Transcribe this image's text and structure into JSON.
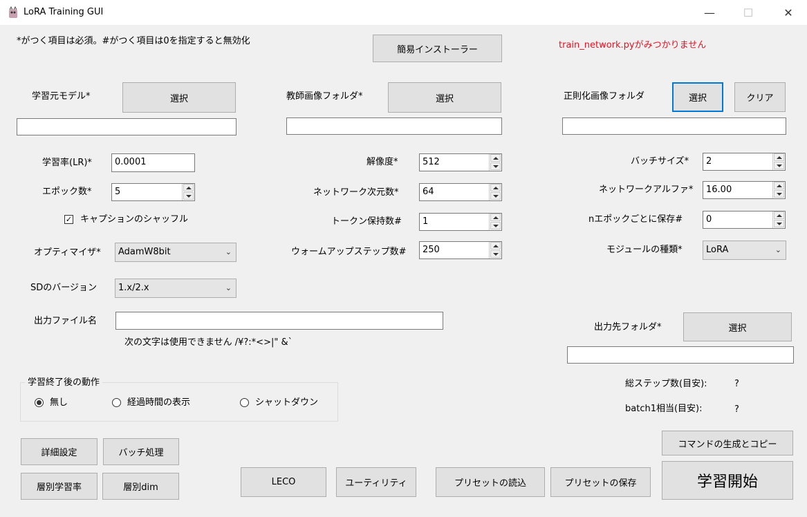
{
  "window": {
    "title": "LoRA Training GUI",
    "minimize": "—",
    "maximize": "☐",
    "close": "✕"
  },
  "notice": {
    "required": "*がつく項目は必須。#がつく項目は0を指定すると無効化",
    "error": "train_network.pyがみつかりません",
    "error_color": "#e81123"
  },
  "installer_button": "簡易インストーラー",
  "source_model": {
    "label": "学習元モデル*",
    "button": "選択",
    "value": ""
  },
  "teacher_folder": {
    "label": "教師画像フォルダ*",
    "button": "選択",
    "value": ""
  },
  "reg_folder": {
    "label": "正則化画像フォルダ",
    "button": "選択",
    "clear": "クリア",
    "value": ""
  },
  "lr": {
    "label": "学習率(LR)*",
    "value": "0.0001"
  },
  "epochs": {
    "label": "エポック数*",
    "value": "5"
  },
  "caption_shuffle": {
    "label": "キャプションのシャッフル",
    "checked": true,
    "mark": "✓"
  },
  "optimizer": {
    "label": "オプティマイザ*",
    "value": "AdamW8bit"
  },
  "sd_version": {
    "label": "SDのバージョン",
    "value": "1.x/2.x"
  },
  "output_name": {
    "label": "出力ファイル名",
    "value": "",
    "note": "次の文字は使用できません /¥?:*<>|\" &`"
  },
  "resolution": {
    "label": "解像度*",
    "value": "512"
  },
  "network_dim": {
    "label": "ネットワーク次元数*",
    "value": "64"
  },
  "keep_tokens": {
    "label": "トークン保持数#",
    "value": "1"
  },
  "warmup": {
    "label": "ウォームアップステップ数#",
    "value": "250"
  },
  "batch_size": {
    "label": "バッチサイズ*",
    "value": "2"
  },
  "network_alpha": {
    "label": "ネットワークアルファ*",
    "value": "16.00"
  },
  "save_every": {
    "label": "nエポックごとに保存#",
    "value": "0"
  },
  "module_type": {
    "label": "モジュールの種類*",
    "value": "LoRA"
  },
  "output_folder": {
    "label": "出力先フォルダ*",
    "button": "選択",
    "value": ""
  },
  "after_training": {
    "title": "学習終了後の動作",
    "options": [
      "無し",
      "経過時間の表示",
      "シャットダウン"
    ],
    "selected": "無し"
  },
  "total_steps": {
    "label": "総ステップ数(目安):",
    "value": "?"
  },
  "batch1": {
    "label": "batch1相当(目安):",
    "value": "?"
  },
  "buttons": {
    "advanced": "詳細設定",
    "batch": "バッチ処理",
    "layer_lr": "層別学習率",
    "layer_dim": "層別dim",
    "leco": "LECO",
    "utility": "ユーティリティ",
    "load_preset": "プリセットの読込",
    "save_preset": "プリセットの保存",
    "gen_command": "コマンドの生成とコピー",
    "start": "学習開始"
  }
}
